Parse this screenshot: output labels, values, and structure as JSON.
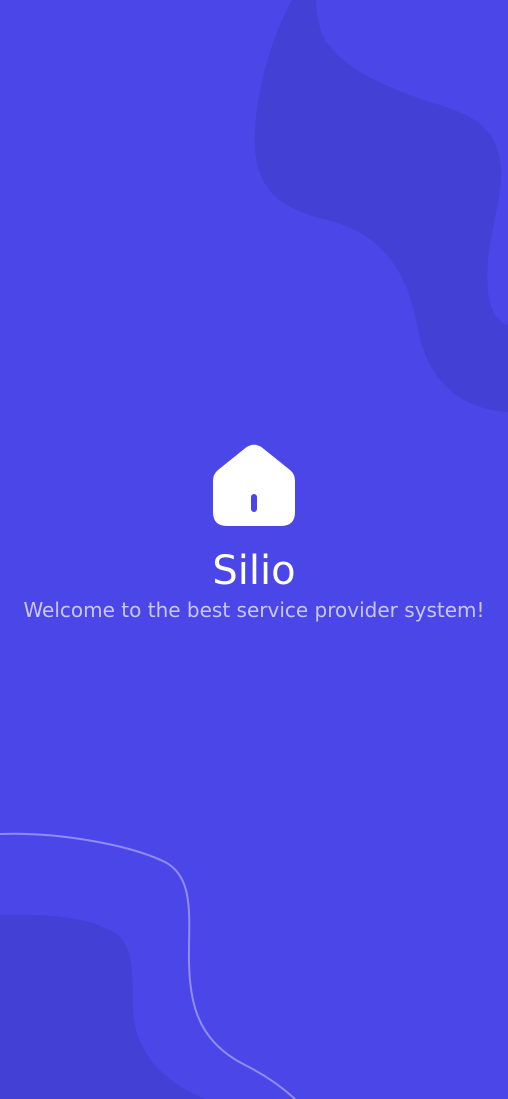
{
  "splash": {
    "app_name": "Silio",
    "tagline": "Welcome to the best service provider system!"
  },
  "icons": {
    "logo": "home-icon"
  },
  "colors": {
    "background": "#4a46e8",
    "blob": "#4340d6",
    "outline": "#8f8df2",
    "title": "#ffffff",
    "tagline": "#c9c7f5"
  }
}
